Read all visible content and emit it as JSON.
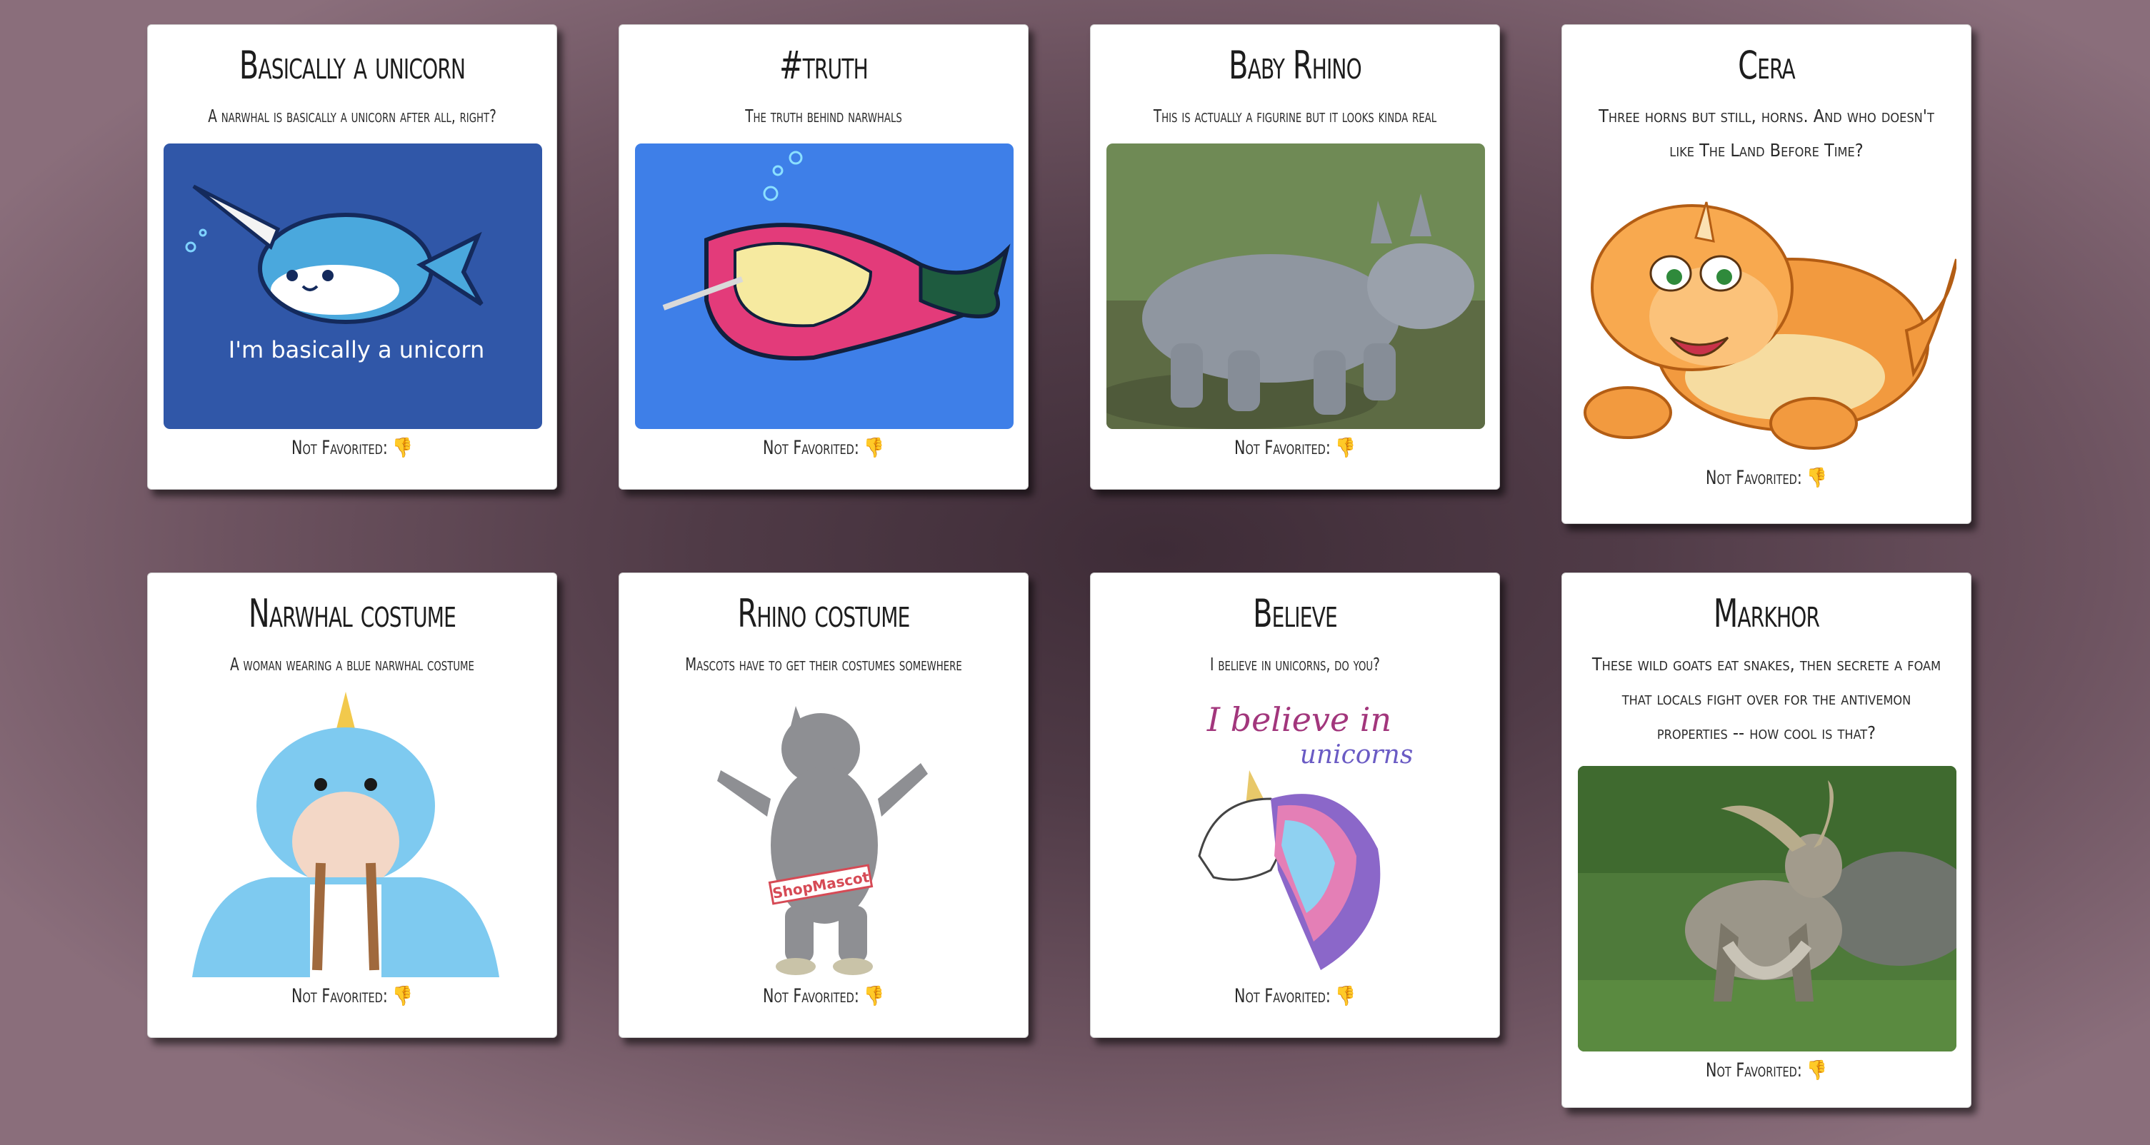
{
  "cards": [
    {
      "title": "Basically a unicorn",
      "description": "A narwhal is basically a unicorn after all, right?",
      "image_text": "I'm basically a unicorn",
      "favorite_label": "Not Favorited:",
      "favorite_icon": "👎"
    },
    {
      "title": "#truth",
      "description": "The truth behind narwhals",
      "favorite_label": "Not Favorited:",
      "favorite_icon": "👎"
    },
    {
      "title": "Baby Rhino",
      "description": "This is actually a figurine but it looks kinda real",
      "favorite_label": "Not Favorited:",
      "favorite_icon": "👎"
    },
    {
      "title": "Cera",
      "description": "Three horns but still, horns. And who doesn't like The Land Before Time?",
      "favorite_label": "Not Favorited:",
      "favorite_icon": "👎"
    },
    {
      "title": "Narwhal costume",
      "description": "A woman wearing a blue narwhal costume",
      "favorite_label": "Not Favorited:",
      "favorite_icon": "👎"
    },
    {
      "title": "Rhino costume",
      "description": "Mascots have to get their costumes somewhere",
      "image_text": "ShopMascot",
      "favorite_label": "Not Favorited:",
      "favorite_icon": "👎"
    },
    {
      "title": "Believe",
      "description": "I believe in unicorns, do you?",
      "image_text_1": "I believe in",
      "image_text_2": "unicorns",
      "favorite_label": "Not Favorited:",
      "favorite_icon": "👎"
    },
    {
      "title": "Markhor",
      "description": "These wild goats eat snakes, then secrete a foam that locals fight over for the antivemon properties -- how cool is that?",
      "favorite_label": "Not Favorited:",
      "favorite_icon": "👎"
    }
  ]
}
